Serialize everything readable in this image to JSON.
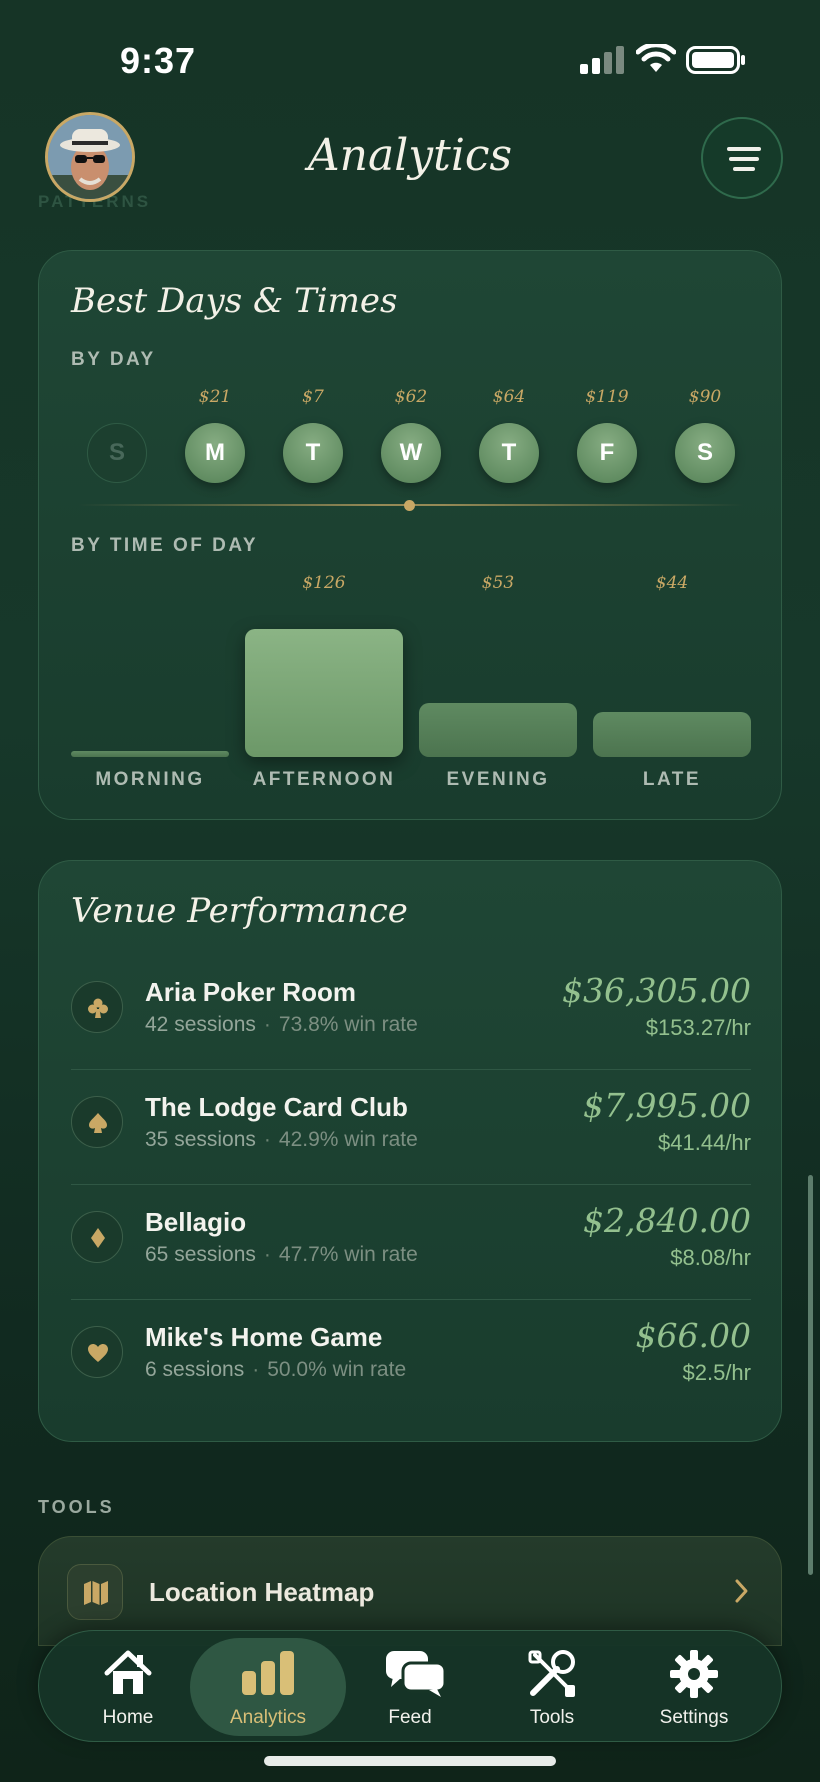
{
  "status_bar": {
    "time": "9:37"
  },
  "header": {
    "title": "Analytics",
    "ghost_label": "PATTERNS"
  },
  "best_days": {
    "title": "Best Days & Times",
    "by_day_label": "BY DAY",
    "days": [
      {
        "letter": "S",
        "amount": "",
        "active": false
      },
      {
        "letter": "M",
        "amount": "$21",
        "active": true
      },
      {
        "letter": "T",
        "amount": "$7",
        "active": true
      },
      {
        "letter": "W",
        "amount": "$62",
        "active": true
      },
      {
        "letter": "T",
        "amount": "$64",
        "active": true
      },
      {
        "letter": "F",
        "amount": "$119",
        "active": true
      },
      {
        "letter": "S",
        "amount": "$90",
        "active": true
      }
    ],
    "by_time_label": "BY TIME OF DAY",
    "times": [
      {
        "label": "MORNING",
        "amount": "",
        "value": 0
      },
      {
        "label": "AFTERNOON",
        "amount": "$126",
        "value": 126
      },
      {
        "label": "EVENING",
        "amount": "$53",
        "value": 53
      },
      {
        "label": "LATE",
        "amount": "$44",
        "value": 44
      }
    ]
  },
  "venue_performance": {
    "title": "Venue Performance",
    "venues": [
      {
        "suit": "club-icon",
        "name": "Aria Poker Room",
        "sessions": "42 sessions",
        "win_rate": "73.8% win rate",
        "profit": "$36,305.00",
        "hourly": "$153.27/hr"
      },
      {
        "suit": "spade-icon",
        "name": "The Lodge Card Club",
        "sessions": "35 sessions",
        "win_rate": "42.9% win rate",
        "profit": "$7,995.00",
        "hourly": "$41.44/hr"
      },
      {
        "suit": "diamond-icon",
        "name": "Bellagio",
        "sessions": "65 sessions",
        "win_rate": "47.7% win rate",
        "profit": "$2,840.00",
        "hourly": "$8.08/hr"
      },
      {
        "suit": "heart-icon",
        "name": "Mike's Home Game",
        "sessions": "6 sessions",
        "win_rate": "50.0% win rate",
        "profit": "$66.00",
        "hourly": "$2.5/hr"
      }
    ]
  },
  "tools": {
    "label": "TOOLS",
    "items": [
      {
        "icon": "map-icon",
        "name": "Location Heatmap"
      }
    ]
  },
  "tab_bar": {
    "tabs": [
      {
        "icon": "home-icon",
        "label": "Home",
        "active": false
      },
      {
        "icon": "bar-chart-icon",
        "label": "Analytics",
        "active": true
      },
      {
        "icon": "chat-bubbles-icon",
        "label": "Feed",
        "active": false
      },
      {
        "icon": "tools-icon",
        "label": "Tools",
        "active": false
      },
      {
        "icon": "gear-icon",
        "label": "Settings",
        "active": false
      }
    ]
  },
  "colors": {
    "accent_gold": "#c9a865",
    "profit_green": "#93c08e",
    "background": "#163426"
  }
}
